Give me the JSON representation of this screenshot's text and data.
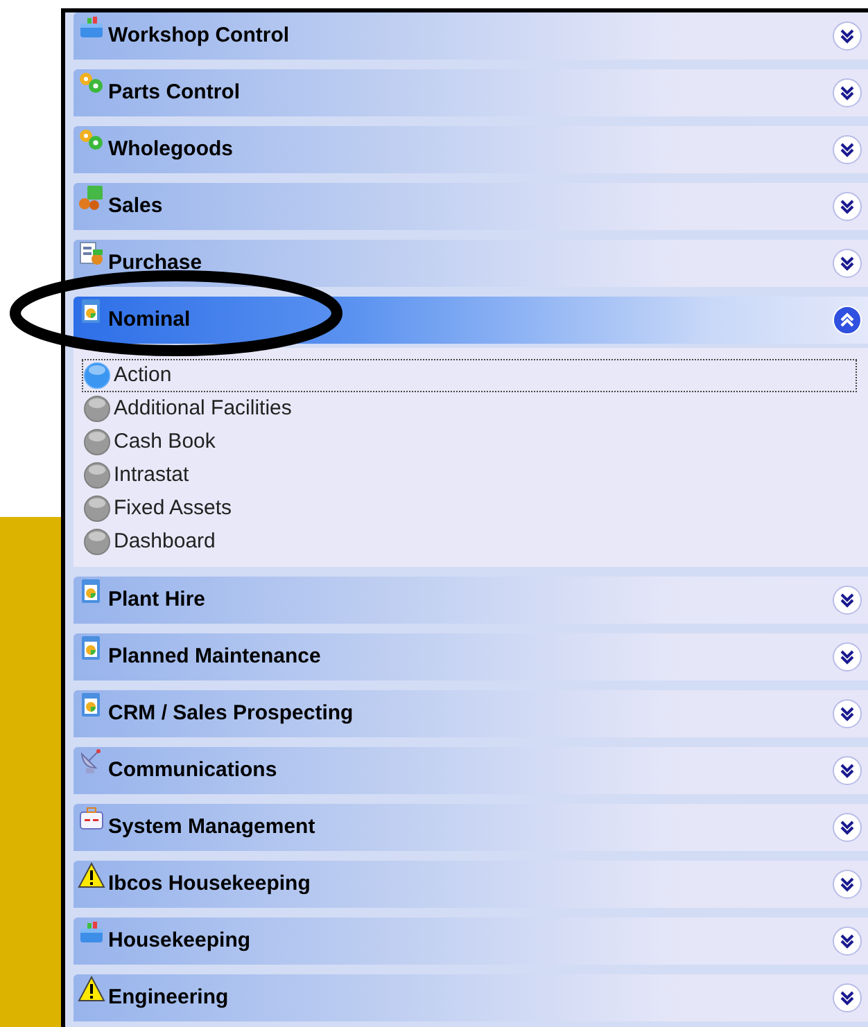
{
  "sections": [
    {
      "kind": "toolbox",
      "title": "Workshop Control",
      "expanded": false
    },
    {
      "kind": "gears",
      "title": "Parts Control",
      "expanded": false
    },
    {
      "kind": "gears",
      "title": "Wholegoods",
      "expanded": false
    },
    {
      "kind": "sales",
      "title": "Sales",
      "expanded": false
    },
    {
      "kind": "purchase",
      "title": "Purchase",
      "expanded": false
    },
    {
      "kind": "report",
      "title": "Nominal",
      "expanded": true,
      "items": [
        {
          "label": "Action",
          "selected": true
        },
        {
          "label": "Additional Facilities",
          "selected": false
        },
        {
          "label": "Cash Book",
          "selected": false
        },
        {
          "label": "Intrastat",
          "selected": false
        },
        {
          "label": "Fixed Assets",
          "selected": false
        },
        {
          "label": "Dashboard",
          "selected": false
        }
      ]
    },
    {
      "kind": "report",
      "title": "Plant Hire",
      "expanded": false
    },
    {
      "kind": "report",
      "title": "Planned Maintenance",
      "expanded": false
    },
    {
      "kind": "report",
      "title": "CRM / Sales Prospecting",
      "expanded": false
    },
    {
      "kind": "comms",
      "title": "Communications",
      "expanded": false
    },
    {
      "kind": "medkit",
      "title": "System Management",
      "expanded": false
    },
    {
      "kind": "warning",
      "title": "Ibcos Housekeeping",
      "expanded": false
    },
    {
      "kind": "toolbox",
      "title": "Housekeeping",
      "expanded": false
    },
    {
      "kind": "warning",
      "title": "Engineering",
      "expanded": false
    }
  ]
}
